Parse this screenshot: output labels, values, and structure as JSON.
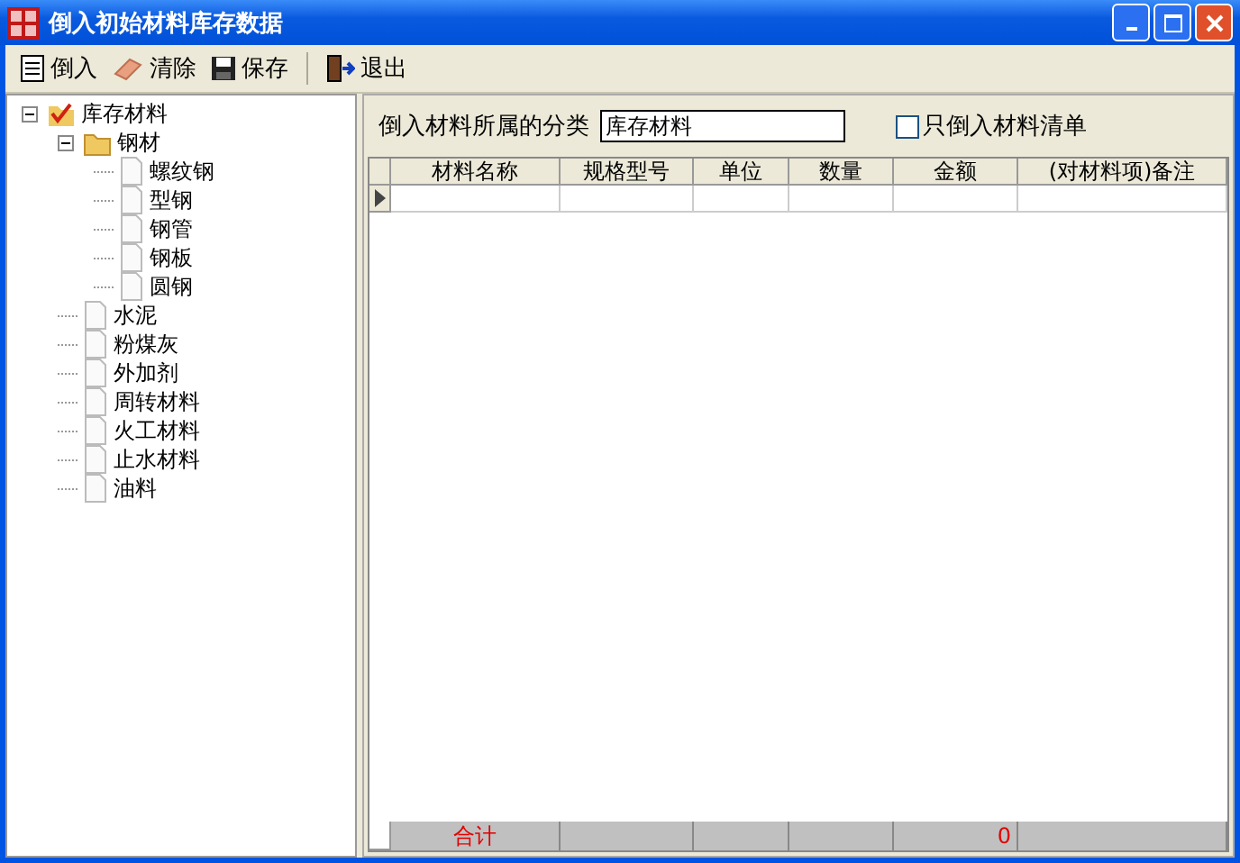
{
  "window": {
    "title": "倒入初始材料库存数据"
  },
  "toolbar": [
    {
      "label": "倒入",
      "kind": "import"
    },
    {
      "label": "清除",
      "kind": "clear"
    },
    {
      "label": "保存",
      "kind": "save"
    },
    {
      "label": "退出",
      "kind": "exit"
    }
  ],
  "tree": [
    {
      "label": "库存材料",
      "kind": "root",
      "expanded": true,
      "children": [
        {
          "label": "钢材",
          "kind": "folder",
          "expanded": true,
          "children": [
            {
              "label": "螺纹钢",
              "kind": "leaf"
            },
            {
              "label": "型钢",
              "kind": "leaf"
            },
            {
              "label": "钢管",
              "kind": "leaf"
            },
            {
              "label": "钢板",
              "kind": "leaf"
            },
            {
              "label": "圆钢",
              "kind": "leaf"
            }
          ]
        },
        {
          "label": "水泥",
          "kind": "leaf"
        },
        {
          "label": "粉煤灰",
          "kind": "leaf"
        },
        {
          "label": "外加剂",
          "kind": "leaf"
        },
        {
          "label": "周转材料",
          "kind": "leaf"
        },
        {
          "label": "火工材料",
          "kind": "leaf"
        },
        {
          "label": "止水材料",
          "kind": "leaf"
        },
        {
          "label": "油料",
          "kind": "leaf"
        }
      ]
    }
  ],
  "category": {
    "label": "倒入材料所属的分类",
    "value": "库存材料"
  },
  "only_list": {
    "label": "只倒入材料清单",
    "checked": false
  },
  "table": {
    "columns": [
      "材料名称",
      "规格型号",
      "单位",
      "数量",
      "金额",
      "(对材料项)备注"
    ],
    "footer": {
      "label": "合计",
      "amount": "0"
    }
  }
}
